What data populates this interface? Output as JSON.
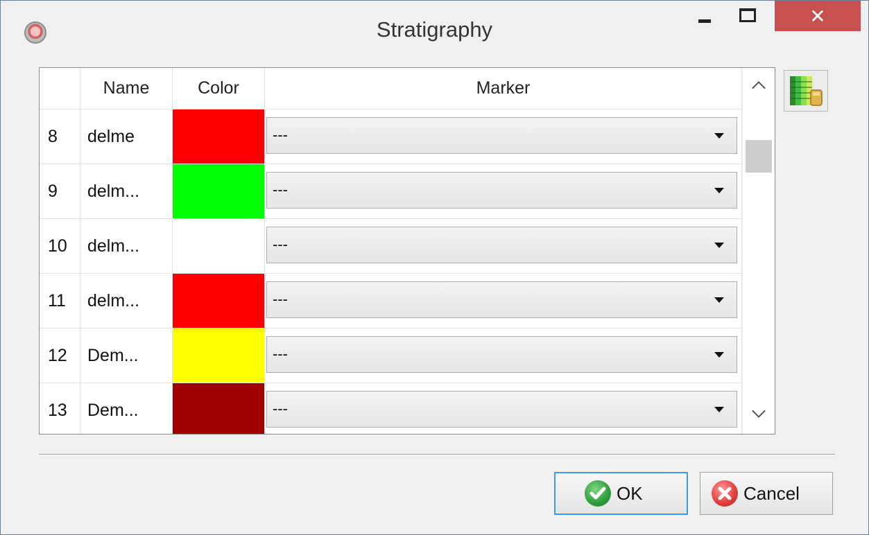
{
  "window": {
    "title": "Stratigraphy",
    "close_glyph": "✕"
  },
  "table": {
    "headers": {
      "number": "",
      "name": "Name",
      "color": "Color",
      "marker": "Marker"
    },
    "rows": [
      {
        "number": "8",
        "name": "delme",
        "color": "#ff0000",
        "marker": "---"
      },
      {
        "number": "9",
        "name": "delm...",
        "color": "#00ff00",
        "marker": "---"
      },
      {
        "number": "10",
        "name": "delm...",
        "color": "#ffffff",
        "marker": "---"
      },
      {
        "number": "11",
        "name": "delm...",
        "color": "#ff0000",
        "marker": "---"
      },
      {
        "number": "12",
        "name": "Dem...",
        "color": "#ffff00",
        "marker": "---"
      },
      {
        "number": "13",
        "name": "Dem...",
        "color": "#a00000",
        "marker": "---"
      }
    ]
  },
  "icons": {
    "app": "app-logo-icon",
    "side": "stratigraphy-legend-icon",
    "ok": "checkmark-icon",
    "cancel": "cancel-x-icon"
  },
  "buttons": {
    "ok_label": "OK",
    "cancel_label": "Cancel"
  }
}
